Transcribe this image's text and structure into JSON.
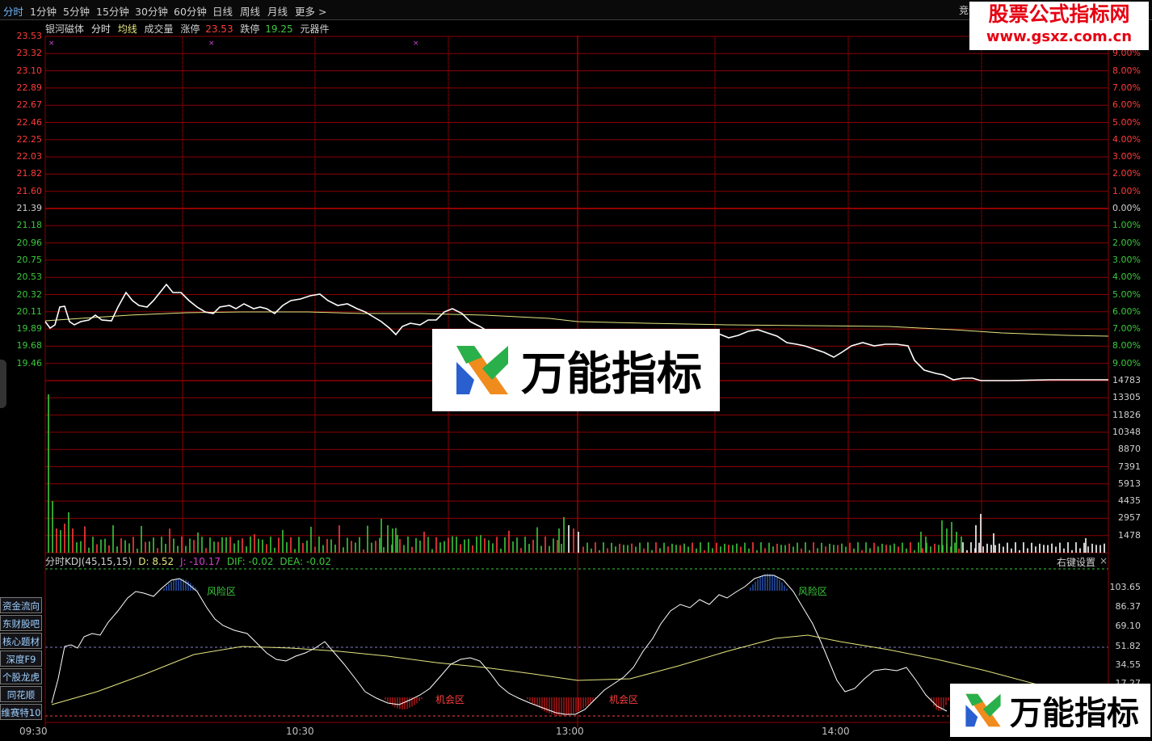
{
  "tabs": [
    "分时",
    "1分钟",
    "5分钟",
    "15分钟",
    "30分钟",
    "60分钟",
    "日线",
    "周线",
    "月线",
    "更多 >"
  ],
  "top_right_tab": "竞价",
  "watermark": {
    "line1": "股票公式指标网",
    "line2": "www.gsxz.com.cn"
  },
  "info": {
    "stock": "银河磁体",
    "mode": "分时",
    "avg": "均线",
    "volume": "成交量",
    "limit_up_label": "涨停",
    "limit_up_value": "23.53",
    "limit_down_label": "跌停",
    "limit_down_value": "19.25",
    "sector": "元器件"
  },
  "price_labels": [
    "23.53",
    "23.32",
    "23.10",
    "22.89",
    "22.67",
    "22.46",
    "22.25",
    "22.03",
    "21.82",
    "21.60",
    "21.39",
    "21.18",
    "20.96",
    "20.75",
    "20.53",
    "20.32",
    "20.11",
    "19.89",
    "19.68",
    "19.46"
  ],
  "pct_labels": [
    "9.00%",
    "8.00%",
    "7.00%",
    "6.00%",
    "5.00%",
    "4.00%",
    "3.00%",
    "2.00%",
    "1.00%",
    "0.00%",
    "1.00%",
    "2.00%",
    "3.00%",
    "4.00%",
    "5.00%",
    "6.00%",
    "7.00%",
    "8.00%",
    "9.00%"
  ],
  "volume_labels": [
    "14783",
    "13305",
    "11826",
    "10348",
    "8870",
    "7391",
    "5913",
    "4435",
    "2957",
    "1478"
  ],
  "kdj": {
    "title": "分时KDJ(45,15,15)",
    "d": "D: 8.52",
    "j": "J: -10.17",
    "dif": "DIF: -0.02",
    "dea": "DEA: -0.02",
    "settings": "右键设置",
    "close": "×"
  },
  "kdj_labels": [
    "103.65",
    "86.37",
    "69.10",
    "51.82",
    "34.55",
    "17.27"
  ],
  "zones": {
    "risk": "风险区",
    "chance": "机会区"
  },
  "side_buttons": [
    "资金流向",
    "东财股吧",
    "核心题材",
    "深度F9",
    "个股龙虎",
    "同花顺",
    "维赛特10"
  ],
  "time_labels": [
    "09:30",
    "10:30",
    "13:00",
    "14:00"
  ],
  "logo_text": "万能指标",
  "colors": {
    "grid": "#8b0000",
    "up": "#ff3c3c",
    "down": "#3cc83c",
    "price_line": "#ffffff",
    "avg_line": "#e6e680",
    "risk": "#3c78ff",
    "chance": "#ff2020"
  }
}
